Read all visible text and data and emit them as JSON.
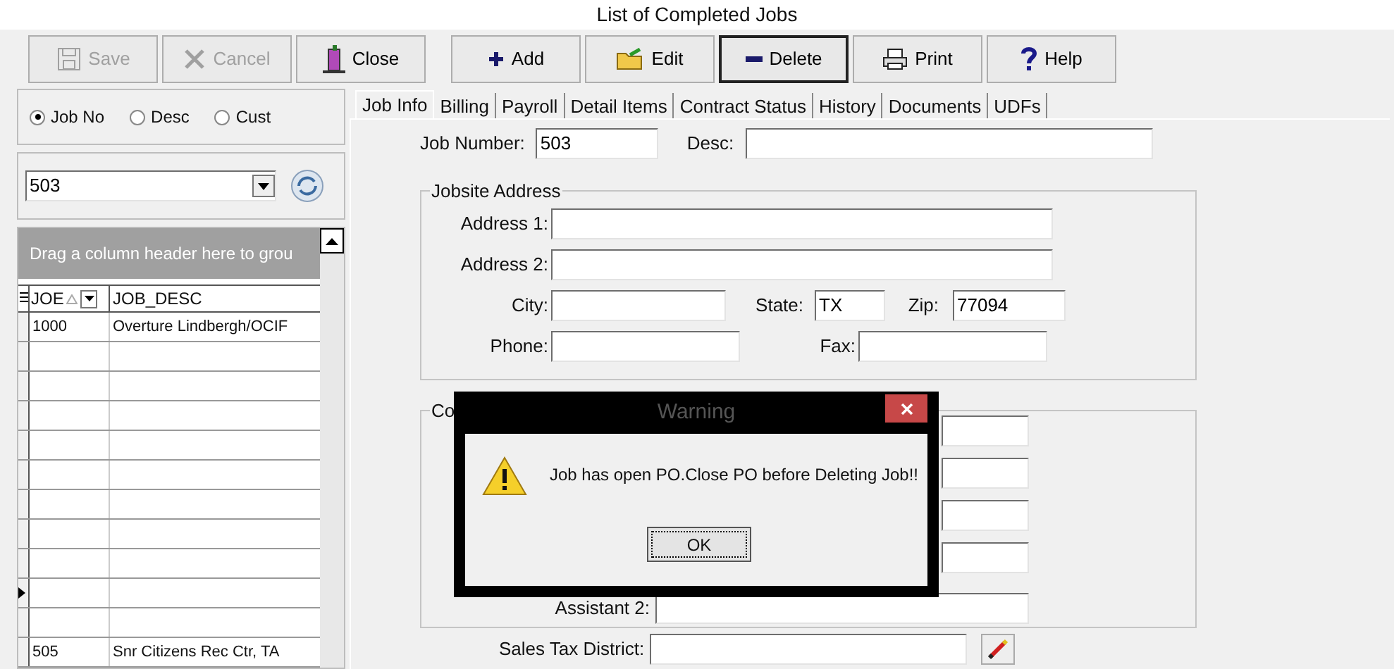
{
  "window": {
    "title": "List of Completed Jobs"
  },
  "toolbar": [
    {
      "label": "Save",
      "disabled": true,
      "pressed": false
    },
    {
      "label": "Cancel",
      "disabled": true,
      "pressed": false
    },
    {
      "label": "Close",
      "disabled": false,
      "pressed": false
    },
    {
      "label": "Add",
      "disabled": false,
      "pressed": false
    },
    {
      "label": "Edit",
      "disabled": false,
      "pressed": false
    },
    {
      "label": "Delete",
      "disabled": false,
      "pressed": true
    },
    {
      "label": "Print",
      "disabled": false,
      "pressed": false
    },
    {
      "label": "Help",
      "disabled": false,
      "pressed": false
    }
  ],
  "search_by": [
    {
      "label": "Job No",
      "selected": true
    },
    {
      "label": "Desc",
      "selected": false
    },
    {
      "label": "Cust",
      "selected": false
    }
  ],
  "job_combo": {
    "value": "503"
  },
  "grid": {
    "group_hint": "Drag a column header here to grou",
    "columns": [
      "JOE",
      "JOB_DESC"
    ],
    "rows": [
      {
        "job": "1000",
        "desc": "Overture Lindbergh/OCIF",
        "selected": false
      },
      {
        "job": "",
        "desc": "",
        "selected": false
      },
      {
        "job": "",
        "desc": "",
        "selected": false
      },
      {
        "job": "",
        "desc": "",
        "selected": false
      },
      {
        "job": "",
        "desc": "",
        "selected": false
      },
      {
        "job": "",
        "desc": "",
        "selected": false
      },
      {
        "job": "",
        "desc": "",
        "selected": false
      },
      {
        "job": "",
        "desc": "",
        "selected": false
      },
      {
        "job": "",
        "desc": "",
        "selected": false
      },
      {
        "job": "",
        "desc": "",
        "selected": true
      },
      {
        "job": "",
        "desc": "",
        "selected": false
      },
      {
        "job": "505",
        "desc": "Snr Citizens Rec Ctr, TA",
        "selected": false
      }
    ]
  },
  "tabs": [
    {
      "label": "Job Info",
      "selected": true
    },
    {
      "label": "Billing",
      "selected": false
    },
    {
      "label": "Payroll",
      "selected": false
    },
    {
      "label": "Detail Items",
      "selected": false
    },
    {
      "label": "Contract Status",
      "selected": false
    },
    {
      "label": "History",
      "selected": false
    },
    {
      "label": "Documents",
      "selected": false
    },
    {
      "label": "UDFs",
      "selected": false
    }
  ],
  "job_info": {
    "job_number_label": "Job Number:",
    "job_number": "503",
    "desc_label": "Desc:",
    "jobsite_address": {
      "title": "Jobsite Address",
      "address1_label": "Address 1:",
      "address2_label": "Address 2:",
      "city_label": "City:",
      "state_label": "State:",
      "state": "TX",
      "zip_label": "Zip:",
      "zip": "77094",
      "phone_label": "Phone:",
      "fax_label": "Fax:"
    },
    "contacts": {
      "title": "Co",
      "assistant2_label": "Assistant 2:"
    },
    "sales_tax_label": "Sales Tax District:"
  },
  "dialog": {
    "title": "Warning",
    "message": "Job has open PO.Close PO before Deleting Job!!",
    "ok": "OK"
  }
}
